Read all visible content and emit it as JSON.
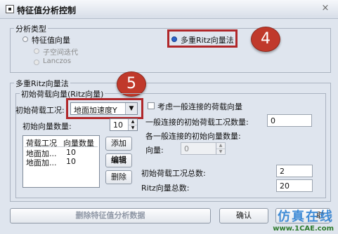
{
  "window": {
    "title": "特征值分析控制",
    "close_glyph": "×"
  },
  "analysis_type": {
    "legend": "分析类型",
    "eigen_vector": "特征值向量",
    "subspace": "子空间迭代",
    "lanczos": "Lanczos",
    "ritz": "多重Ritz向量法"
  },
  "ritz": {
    "legend": "多重Ritz向量法",
    "initial_group_legend": "初始荷载向量(Ritz向量)",
    "load_case_label": "初始荷载工况:",
    "load_case_value": "地面加速度Y",
    "initial_count_label": "初始向量数量:",
    "initial_count_value": "10",
    "list": {
      "col1": "荷载工况",
      "col2": "向量数量",
      "rows": [
        {
          "case": "地面加...",
          "count": "10"
        },
        {
          "case": "地面加...",
          "count": "10"
        }
      ]
    },
    "add_label": "添加",
    "edit_label": "编辑",
    "delete_label": "删除",
    "general_conn_check_label": "考虑一般连接的荷载向量",
    "general_conn_initial_label": "一般连接的初始荷载工况数量:",
    "general_conn_initial_value": "0",
    "general_conn_count_label": "各一般连接的初始向量数量:",
    "vector_label": "向量:",
    "vector_value": "0",
    "total_cases_label": "初始荷载工况总数:",
    "total_cases_value": "2",
    "ritz_total_label": "Ritz向量总数:",
    "ritz_total_value": "20"
  },
  "footer": {
    "delete_data_label": "删除特征值分析数据",
    "ok_label": "确认",
    "cancel_partial": "取"
  },
  "badges": {
    "step4": "4",
    "step5": "5"
  },
  "watermark": {
    "big": "仿真在线",
    "small": "www.1CAE.com"
  },
  "colors": {
    "highlight": "#b0272a",
    "badge": "#c0392b",
    "accent": "#2a62c9"
  }
}
